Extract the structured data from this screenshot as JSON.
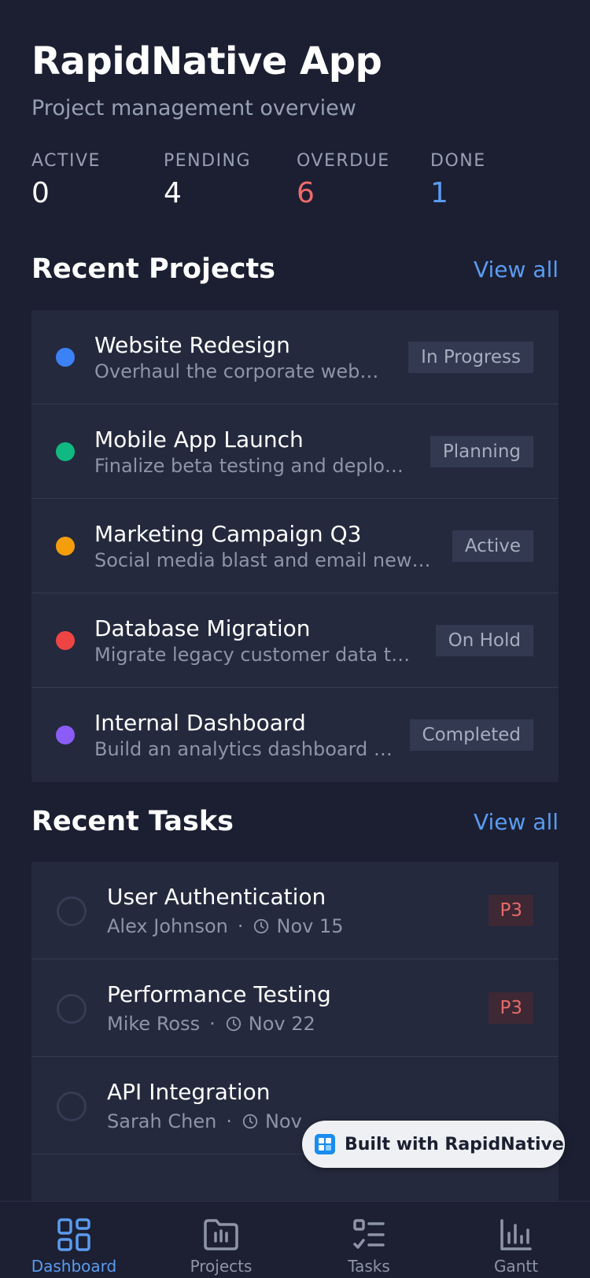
{
  "header": {
    "title": "RapidNative App",
    "subtitle": "Project management overview"
  },
  "stats": [
    {
      "label": "ACTIVE",
      "value": "0",
      "color": "#ffffff"
    },
    {
      "label": "PENDING",
      "value": "4",
      "color": "#ffffff"
    },
    {
      "label": "OVERDUE",
      "value": "6",
      "color": "#ef6b6b"
    },
    {
      "label": "DONE",
      "value": "1",
      "color": "#5b9bf0"
    }
  ],
  "projects_section": {
    "title": "Recent Projects",
    "view_all": "View all",
    "items": [
      {
        "name": "Website Redesign",
        "description": "Overhaul the corporate website...",
        "status": "In Progress",
        "color": "#3b82f6"
      },
      {
        "name": "Mobile App Launch",
        "description": "Finalize beta testing and deploy to...",
        "status": "Planning",
        "color": "#10b981"
      },
      {
        "name": "Marketing Campaign Q3",
        "description": "Social media blast and email newslet...",
        "status": "Active",
        "color": "#f59e0b"
      },
      {
        "name": "Database Migration",
        "description": "Migrate legacy customer data to th...",
        "status": "On Hold",
        "color": "#ef4444"
      },
      {
        "name": "Internal Dashboard",
        "description": "Build an analytics dashboard for...",
        "status": "Completed",
        "color": "#8b5cf6"
      }
    ]
  },
  "tasks_section": {
    "title": "Recent Tasks",
    "view_all": "View all",
    "items": [
      {
        "name": "User Authentication",
        "assignee": "Alex Johnson",
        "separator": "·",
        "due": "Nov 15",
        "priority": "P3"
      },
      {
        "name": "Performance Testing",
        "assignee": "Mike Ross",
        "separator": "·",
        "due": "Nov 22",
        "priority": "P3"
      },
      {
        "name": "API Integration",
        "assignee": "Sarah Chen",
        "separator": "·",
        "due": "Nov",
        "priority": ""
      }
    ]
  },
  "badge": {
    "text": "Built with RapidNative",
    "icon": "rapidnative-logo-icon"
  },
  "tabbar": {
    "active_color": "#5b9bf0",
    "inactive_color": "#8d95a7",
    "tabs": [
      {
        "label": "Dashboard",
        "icon": "dashboard-grid-icon",
        "active": true
      },
      {
        "label": "Projects",
        "icon": "folder-icon",
        "active": false
      },
      {
        "label": "Tasks",
        "icon": "task-list-icon",
        "active": false
      },
      {
        "label": "Gantt",
        "icon": "bar-chart-icon",
        "active": false
      }
    ]
  }
}
